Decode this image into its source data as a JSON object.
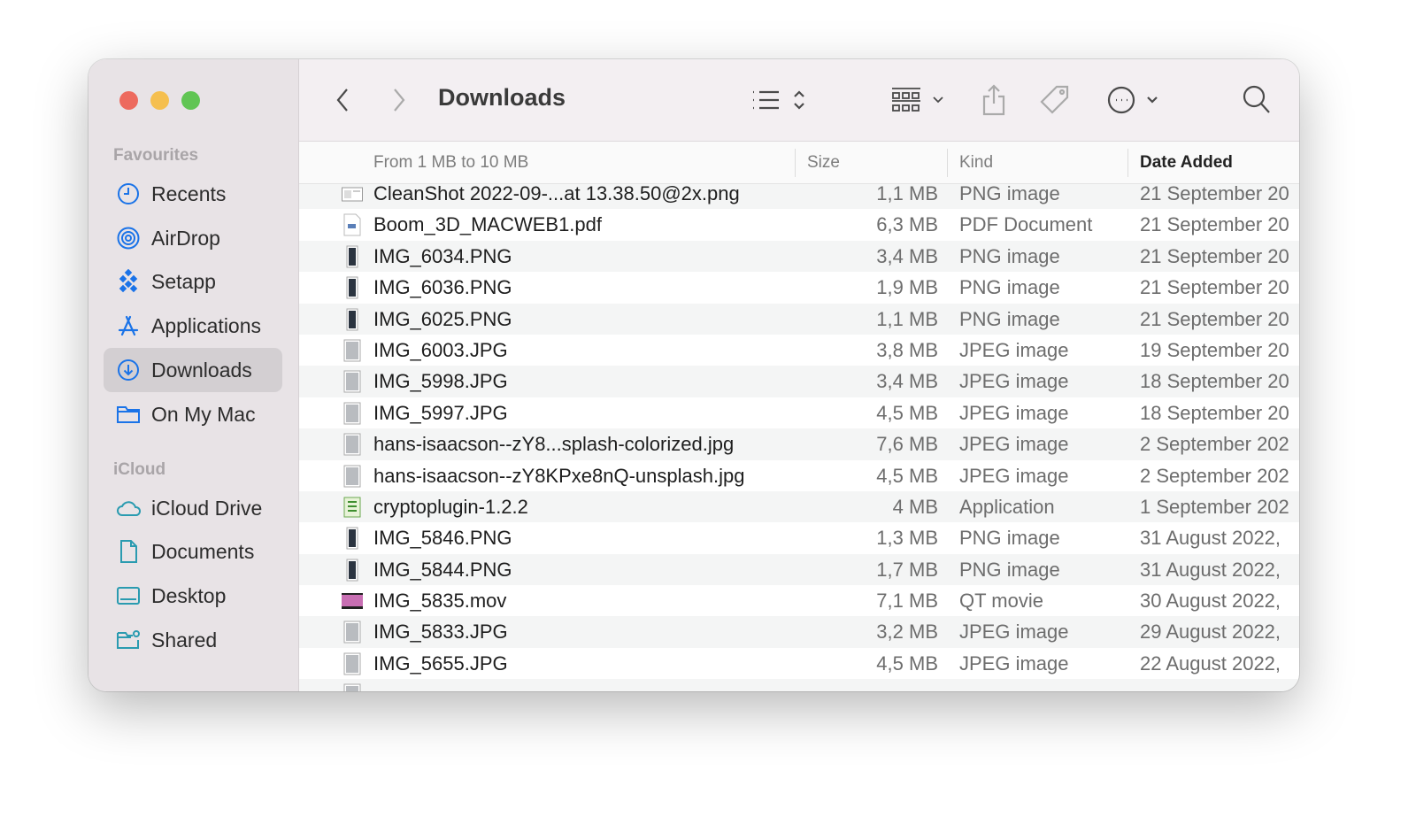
{
  "window": {
    "title": "Downloads",
    "colors": {
      "close": "#ed6a5e",
      "minimize": "#f5bf4f",
      "zoom": "#61c554",
      "accent": "#1a73e8",
      "icloud": "#2a9bb0"
    }
  },
  "sidebar": {
    "favourites_label": "Favourites",
    "favourites": [
      {
        "label": "Recents",
        "icon": "clock-icon"
      },
      {
        "label": "AirDrop",
        "icon": "airdrop-icon"
      },
      {
        "label": "Setapp",
        "icon": "setapp-icon"
      },
      {
        "label": "Applications",
        "icon": "applications-icon"
      },
      {
        "label": "Downloads",
        "icon": "download-icon",
        "selected": true
      },
      {
        "label": "On My Mac",
        "icon": "folder-icon"
      }
    ],
    "icloud_label": "iCloud",
    "icloud": [
      {
        "label": "iCloud Drive",
        "icon": "cloud-icon"
      },
      {
        "label": "Documents",
        "icon": "document-icon"
      },
      {
        "label": "Desktop",
        "icon": "desktop-icon"
      },
      {
        "label": "Shared",
        "icon": "shared-folder-icon"
      }
    ]
  },
  "toolbar": {
    "back": "chevron-left-icon",
    "forward": "chevron-right-icon",
    "view": "list-view-icon",
    "group": "group-icon",
    "share": "share-icon",
    "tag": "tag-icon",
    "more": "more-icon",
    "search": "search-icon"
  },
  "columns": {
    "name": "From 1 MB to 10 MB",
    "size": "Size",
    "kind": "Kind",
    "date": "Date Added"
  },
  "files": [
    {
      "name": "CleanShot 2022-09-...at 13.38.50@2x.png",
      "size": "1,1 MB",
      "kind": "PNG image",
      "date": "21 September 20",
      "icon": "screenshot"
    },
    {
      "name": "Boom_3D_MACWEB1.pdf",
      "size": "6,3 MB",
      "kind": "PDF Document",
      "date": "21 September 20",
      "icon": "pdf"
    },
    {
      "name": "IMG_6034.PNG",
      "size": "3,4 MB",
      "kind": "PNG image",
      "date": "21 September 20",
      "icon": "phone"
    },
    {
      "name": "IMG_6036.PNG",
      "size": "1,9 MB",
      "kind": "PNG image",
      "date": "21 September 20",
      "icon": "phone"
    },
    {
      "name": "IMG_6025.PNG",
      "size": "1,1 MB",
      "kind": "PNG image",
      "date": "21 September 20",
      "icon": "phone"
    },
    {
      "name": "IMG_6003.JPG",
      "size": "3,8 MB",
      "kind": "JPEG image",
      "date": "19 September 20",
      "icon": "photo"
    },
    {
      "name": "IMG_5998.JPG",
      "size": "3,4 MB",
      "kind": "JPEG image",
      "date": "18 September 20",
      "icon": "photo"
    },
    {
      "name": "IMG_5997.JPG",
      "size": "4,5 MB",
      "kind": "JPEG image",
      "date": "18 September 20",
      "icon": "photo"
    },
    {
      "name": "hans-isaacson--zY8...splash-colorized.jpg",
      "size": "7,6 MB",
      "kind": "JPEG image",
      "date": "2 September 202",
      "icon": "photo"
    },
    {
      "name": "hans-isaacson--zY8KPxe8nQ-unsplash.jpg",
      "size": "4,5 MB",
      "kind": "JPEG image",
      "date": "2 September 202",
      "icon": "photo"
    },
    {
      "name": "cryptoplugin-1.2.2",
      "size": "4 MB",
      "kind": "Application",
      "date": "1 September 202",
      "icon": "app"
    },
    {
      "name": "IMG_5846.PNG",
      "size": "1,3 MB",
      "kind": "PNG image",
      "date": "31 August 2022,",
      "icon": "phone"
    },
    {
      "name": "IMG_5844.PNG",
      "size": "1,7 MB",
      "kind": "PNG image",
      "date": "31 August 2022,",
      "icon": "phone"
    },
    {
      "name": "IMG_5835.mov",
      "size": "7,1 MB",
      "kind": "QT movie",
      "date": "30 August 2022,",
      "icon": "movie"
    },
    {
      "name": "IMG_5833.JPG",
      "size": "3,2 MB",
      "kind": "JPEG image",
      "date": "29 August 2022,",
      "icon": "photo"
    },
    {
      "name": "IMG_5655.JPG",
      "size": "4,5 MB",
      "kind": "JPEG image",
      "date": "22 August 2022,",
      "icon": "photo"
    }
  ]
}
